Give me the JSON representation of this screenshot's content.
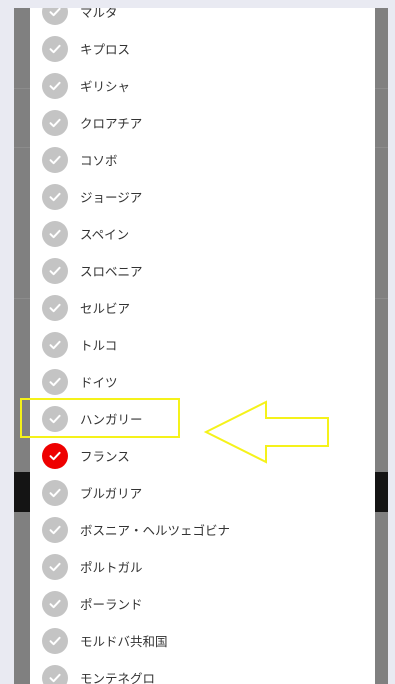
{
  "countries": {
    "items": [
      {
        "label": "マルタ",
        "selected": false
      },
      {
        "label": "キプロス",
        "selected": false
      },
      {
        "label": "ギリシャ",
        "selected": false
      },
      {
        "label": "クロアチア",
        "selected": false
      },
      {
        "label": "コソボ",
        "selected": false
      },
      {
        "label": "ジョージア",
        "selected": false
      },
      {
        "label": "スペイン",
        "selected": false
      },
      {
        "label": "スロベニア",
        "selected": false
      },
      {
        "label": "セルビア",
        "selected": false
      },
      {
        "label": "トルコ",
        "selected": false
      },
      {
        "label": "ドイツ",
        "selected": false
      },
      {
        "label": "ハンガリー",
        "selected": false
      },
      {
        "label": "フランス",
        "selected": true
      },
      {
        "label": "ブルガリア",
        "selected": false
      },
      {
        "label": "ボスニア・ヘルツェゴビナ",
        "selected": false
      },
      {
        "label": "ポルトガル",
        "selected": false
      },
      {
        "label": "ポーランド",
        "selected": false
      },
      {
        "label": "モルドバ共和国",
        "selected": false
      },
      {
        "label": "モンテネグロ",
        "selected": false
      }
    ]
  },
  "colors": {
    "selected": "#ee0000",
    "unselected": "#c4c4c4",
    "annotation": "#f5f21a"
  },
  "icons": {
    "check": "check-icon",
    "arrow": "left-arrow-icon"
  }
}
